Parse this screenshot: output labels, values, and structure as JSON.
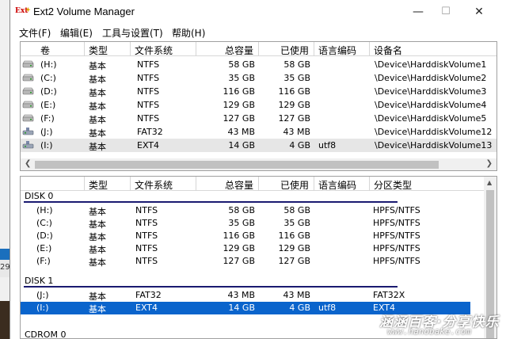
{
  "window": {
    "title": "Ext2 Volume Manager",
    "icon_text": "Ext",
    "minimize_glyph": "—",
    "maximize_glyph": "☐",
    "close_glyph": "✕"
  },
  "menu": [
    {
      "label": "文件(F)"
    },
    {
      "label": "编辑(E)"
    },
    {
      "label": "工具与设置(T)"
    },
    {
      "label": "帮助(H)"
    }
  ],
  "volumes": {
    "columns": [
      "卷",
      "类型",
      "文件系统",
      "总容量",
      "已使用",
      "语言编码",
      "设备名"
    ],
    "rows": [
      {
        "vol": "(H:)",
        "type": "基本",
        "fs": "NTFS",
        "total": "58 GB",
        "used": "58 GB",
        "codepage": "",
        "device": "\\Device\\HarddiskVolume1",
        "icon": "disk-icon"
      },
      {
        "vol": "(C:)",
        "type": "基本",
        "fs": "NTFS",
        "total": "35 GB",
        "used": "35 GB",
        "codepage": "",
        "device": "\\Device\\HarddiskVolume2",
        "icon": "disk-icon"
      },
      {
        "vol": "(D:)",
        "type": "基本",
        "fs": "NTFS",
        "total": "116 GB",
        "used": "116 GB",
        "codepage": "",
        "device": "\\Device\\HarddiskVolume3",
        "icon": "disk-icon"
      },
      {
        "vol": "(E:)",
        "type": "基本",
        "fs": "NTFS",
        "total": "129 GB",
        "used": "129 GB",
        "codepage": "",
        "device": "\\Device\\HarddiskVolume4",
        "icon": "disk-icon"
      },
      {
        "vol": "(F:)",
        "type": "基本",
        "fs": "NTFS",
        "total": "127 GB",
        "used": "127 GB",
        "codepage": "",
        "device": "\\Device\\HarddiskVolume5",
        "icon": "disk-icon"
      },
      {
        "vol": "(J:)",
        "type": "基本",
        "fs": "FAT32",
        "total": "43 MB",
        "used": "43 MB",
        "codepage": "",
        "device": "\\Device\\HarddiskVolume12",
        "icon": "usb-disk-icon"
      },
      {
        "vol": "(I:)",
        "type": "基本",
        "fs": "EXT4",
        "total": "14 GB",
        "used": "4 GB",
        "codepage": "utf8",
        "device": "\\Device\\HarddiskVolume13",
        "icon": "usb-disk-icon",
        "selected": true
      }
    ],
    "scroll_left": "❮",
    "scroll_right": "❯"
  },
  "partitions": {
    "columns": [
      "",
      "类型",
      "文件系统",
      "总容量",
      "已使用",
      "语言编码",
      "分区类型"
    ],
    "disks": [
      {
        "name": "DISK 0",
        "rows": [
          {
            "vol": "(H:)",
            "type": "基本",
            "fs": "NTFS",
            "total": "58 GB",
            "used": "58 GB",
            "codepage": "",
            "ptype": "HPFS/NTFS"
          },
          {
            "vol": "(C:)",
            "type": "基本",
            "fs": "NTFS",
            "total": "35 GB",
            "used": "35 GB",
            "codepage": "",
            "ptype": "HPFS/NTFS"
          },
          {
            "vol": "(D:)",
            "type": "基本",
            "fs": "NTFS",
            "total": "116 GB",
            "used": "116 GB",
            "codepage": "",
            "ptype": "HPFS/NTFS"
          },
          {
            "vol": "(E:)",
            "type": "基本",
            "fs": "NTFS",
            "total": "129 GB",
            "used": "129 GB",
            "codepage": "",
            "ptype": "HPFS/NTFS"
          },
          {
            "vol": "(F:)",
            "type": "基本",
            "fs": "NTFS",
            "total": "127 GB",
            "used": "127 GB",
            "codepage": "",
            "ptype": "HPFS/NTFS"
          }
        ]
      },
      {
        "name": "DISK 1",
        "rows": [
          {
            "vol": "(J:)",
            "type": "基本",
            "fs": "FAT32",
            "total": "43 MB",
            "used": "43 MB",
            "codepage": "",
            "ptype": "FAT32X"
          },
          {
            "vol": "(I:)",
            "type": "基本",
            "fs": "EXT4",
            "total": "14 GB",
            "used": "4 GB",
            "codepage": "utf8",
            "ptype": "EXT4",
            "selected": true
          }
        ]
      },
      {
        "name": "CDROM 0",
        "rows": []
      }
    ],
    "scroll_up": "▲"
  },
  "background": {
    "left_text": "29"
  },
  "watermark": {
    "line1": "涵涵百客·分享快乐",
    "line2": "www.hanobake.com"
  },
  "colors": {
    "selection": "#0a64cc",
    "disk_rule": "#1a1a70"
  }
}
